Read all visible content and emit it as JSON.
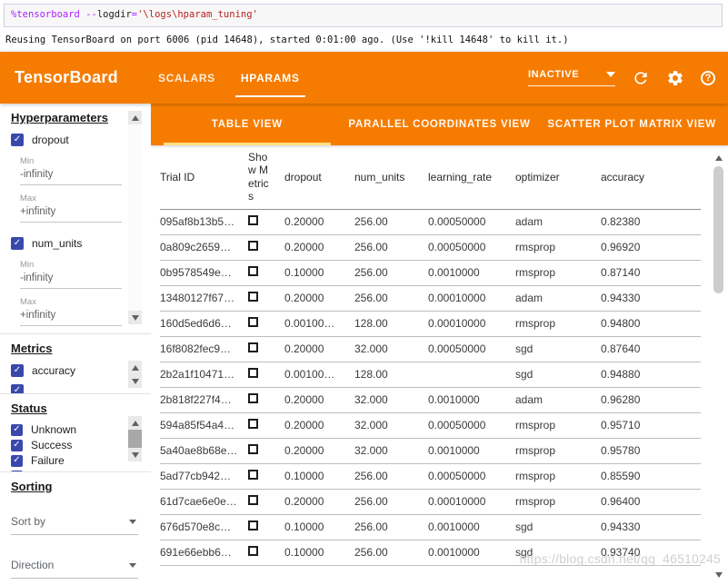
{
  "colors": {
    "orange": "#f57c00",
    "tab_underline": "#ffe082",
    "checkbox_blue": "#3949ab"
  },
  "icons": {
    "help_glyph": "?"
  },
  "notebook": {
    "code_tokens": [
      {
        "text": "%tensorboard ",
        "color": "#AA22FF"
      },
      {
        "text": "--",
        "color": "#AA22FF"
      },
      {
        "text": "logdir",
        "color": "#212121"
      },
      {
        "text": "=",
        "color": "#AA22FF"
      },
      {
        "text": "'\\logs\\hparam_tuning'",
        "color": "#BA2121"
      }
    ],
    "output_text": "Reusing TensorBoard on port 6006 (pid 14648), started 0:01:00 ago. (Use '!kill 14648' to kill it.)"
  },
  "header": {
    "title": "TensorBoard",
    "tabs": [
      {
        "label": "SCALARS",
        "active": false
      },
      {
        "label": "HPARAMS",
        "active": true
      }
    ],
    "status_label": "INACTIVE"
  },
  "sidebar": {
    "hyperparameters": {
      "heading": "Hyperparameters",
      "min_label": "Min",
      "max_label": "Max",
      "params": [
        {
          "label": "dropout",
          "checked": true,
          "min": "-infinity",
          "max": "+infinity"
        },
        {
          "label": "num_units",
          "checked": true,
          "min": "-infinity",
          "max": "+infinity"
        }
      ]
    },
    "metrics": {
      "heading": "Metrics",
      "items": [
        {
          "label": "accuracy",
          "checked": true
        }
      ],
      "more_clipped": true
    },
    "status": {
      "heading": "Status",
      "items": [
        {
          "label": "Unknown",
          "checked": true
        },
        {
          "label": "Success",
          "checked": true
        },
        {
          "label": "Failure",
          "checked": true
        }
      ],
      "more_clipped": true
    },
    "sorting": {
      "heading": "Sorting",
      "sort_by_label": "Sort by",
      "direction_label": "Direction"
    }
  },
  "main": {
    "view_tabs": [
      {
        "label": "TABLE VIEW",
        "active": true
      },
      {
        "label": "PARALLEL COORDINATES VIEW",
        "active": false
      },
      {
        "label": "SCATTER PLOT MATRIX VIEW",
        "active": false
      }
    ],
    "table": {
      "columns": [
        "Trial ID",
        "Show Metrics",
        "dropout",
        "num_units",
        "learning_rate",
        "optimizer",
        "accuracy"
      ],
      "rows": [
        {
          "trial_id": "095af8b13b5…",
          "show": false,
          "dropout": "0.20000",
          "num_units": "256.00",
          "learning_rate": "0.00050000",
          "optimizer": "adam",
          "accuracy": "0.82380"
        },
        {
          "trial_id": "0a809c2659…",
          "show": false,
          "dropout": "0.20000",
          "num_units": "256.00",
          "learning_rate": "0.00050000",
          "optimizer": "rmsprop",
          "accuracy": "0.96920"
        },
        {
          "trial_id": "0b9578549e…",
          "show": false,
          "dropout": "0.10000",
          "num_units": "256.00",
          "learning_rate": "0.0010000",
          "optimizer": "rmsprop",
          "accuracy": "0.87140"
        },
        {
          "trial_id": "13480127f67…",
          "show": false,
          "dropout": "0.20000",
          "num_units": "256.00",
          "learning_rate": "0.00010000",
          "optimizer": "adam",
          "accuracy": "0.94330"
        },
        {
          "trial_id": "160d5ed6d6…",
          "show": false,
          "dropout": "0.00100…",
          "num_units": "128.00",
          "learning_rate": "0.00010000",
          "optimizer": "rmsprop",
          "accuracy": "0.94800"
        },
        {
          "trial_id": "16f8082fec9…",
          "show": false,
          "dropout": "0.20000",
          "num_units": "32.000",
          "learning_rate": "0.00050000",
          "optimizer": "sgd",
          "accuracy": "0.87640"
        },
        {
          "trial_id": "2b2a1f10471…",
          "show": false,
          "dropout": "0.00100…",
          "num_units": "128.00",
          "learning_rate": "",
          "optimizer": "sgd",
          "accuracy": "0.94880"
        },
        {
          "trial_id": "2b818f227f4…",
          "show": false,
          "dropout": "0.20000",
          "num_units": "32.000",
          "learning_rate": "0.0010000",
          "optimizer": "adam",
          "accuracy": "0.96280"
        },
        {
          "trial_id": "594a85f54a4…",
          "show": false,
          "dropout": "0.20000",
          "num_units": "32.000",
          "learning_rate": "0.00050000",
          "optimizer": "rmsprop",
          "accuracy": "0.95710"
        },
        {
          "trial_id": "5a40ae8b68e…",
          "show": false,
          "dropout": "0.20000",
          "num_units": "32.000",
          "learning_rate": "0.0010000",
          "optimizer": "rmsprop",
          "accuracy": "0.95780"
        },
        {
          "trial_id": "5ad77cb942…",
          "show": false,
          "dropout": "0.10000",
          "num_units": "256.00",
          "learning_rate": "0.00050000",
          "optimizer": "rmsprop",
          "accuracy": "0.85590"
        },
        {
          "trial_id": "61d7cae6e0e…",
          "show": false,
          "dropout": "0.20000",
          "num_units": "256.00",
          "learning_rate": "0.00010000",
          "optimizer": "rmsprop",
          "accuracy": "0.96400"
        },
        {
          "trial_id": "676d570e8c…",
          "show": false,
          "dropout": "0.10000",
          "num_units": "256.00",
          "learning_rate": "0.0010000",
          "optimizer": "sgd",
          "accuracy": "0.94330"
        },
        {
          "trial_id": "691e66ebb6…",
          "show": false,
          "dropout": "0.10000",
          "num_units": "256.00",
          "learning_rate": "0.0010000",
          "optimizer": "sgd",
          "accuracy": "0.93740"
        }
      ]
    }
  },
  "watermark": "https://blog.csdn.net/qq_46510245"
}
